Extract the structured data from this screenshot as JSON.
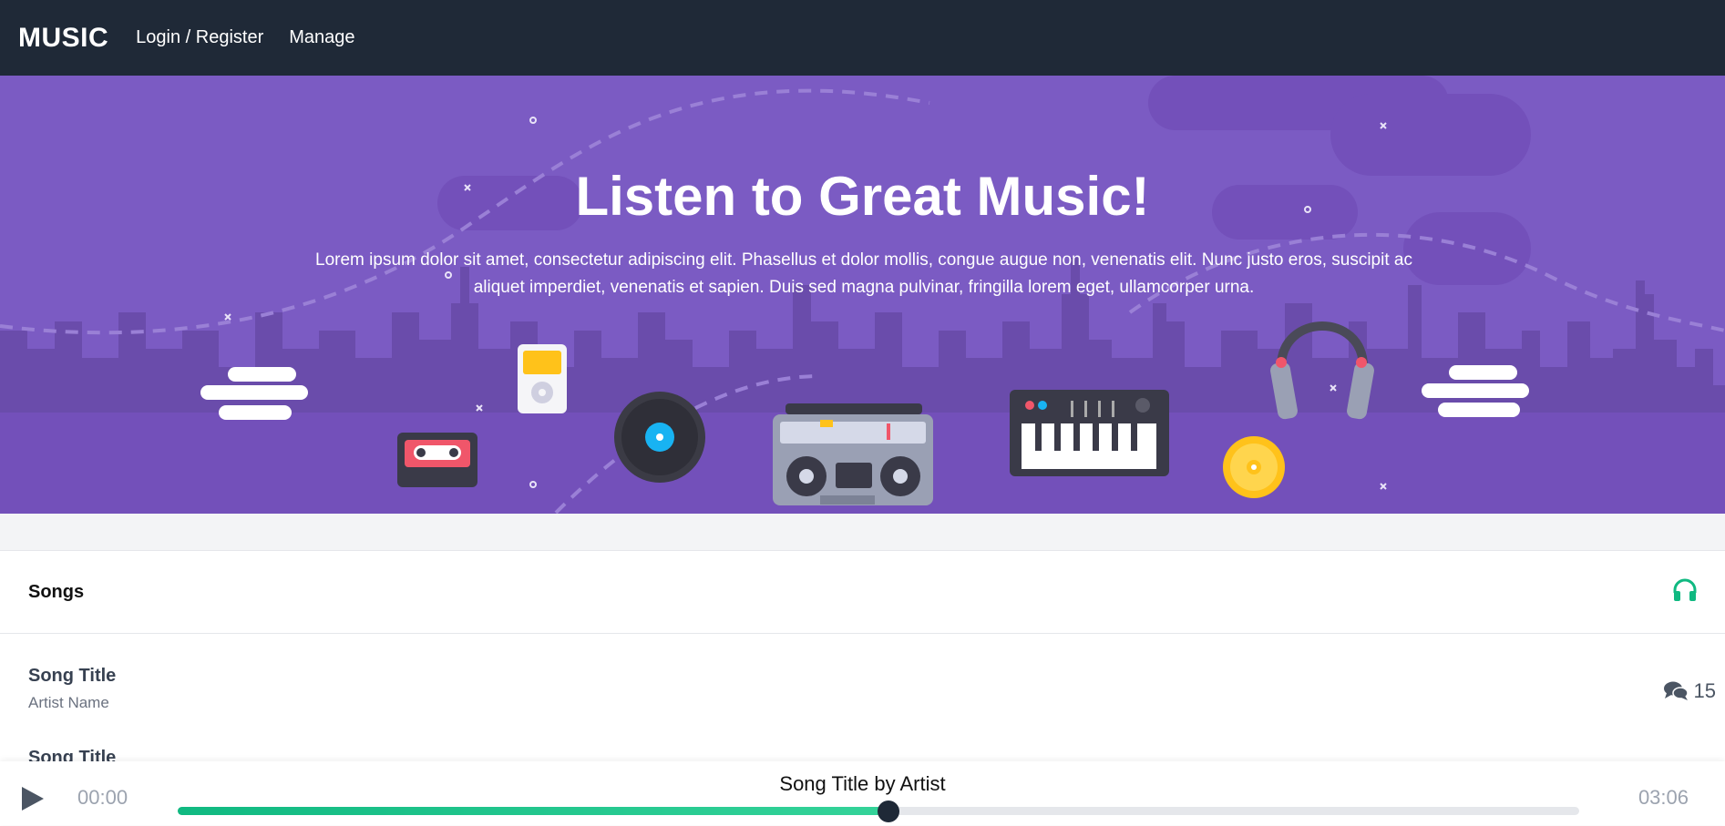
{
  "nav": {
    "brand": "MUSIC",
    "links": [
      "Login / Register",
      "Manage"
    ]
  },
  "hero": {
    "title": "Listen to Great Music!",
    "text": "Lorem ipsum dolor sit amet, consectetur adipiscing elit. Phasellus et dolor mollis, congue augue non, venenatis elit. Nunc justo eros, suscipit ac aliquet imperdiet, venenatis et sapien. Duis sed magna pulvinar, fringilla lorem eget, ullamcorper urna."
  },
  "songs": {
    "header": "Songs",
    "header_icon": "headphones-icon",
    "items": [
      {
        "title": "Song Title",
        "artist": "Artist Name",
        "comments": "15"
      },
      {
        "title": "Song Title"
      }
    ]
  },
  "player": {
    "current_time": "00:00",
    "duration": "03:06",
    "now_playing": "Song Title by Artist",
    "progress": 0.507
  },
  "colors": {
    "nav": "#1f2937",
    "hero": "#7b5bc3",
    "accent": "#10b981"
  }
}
